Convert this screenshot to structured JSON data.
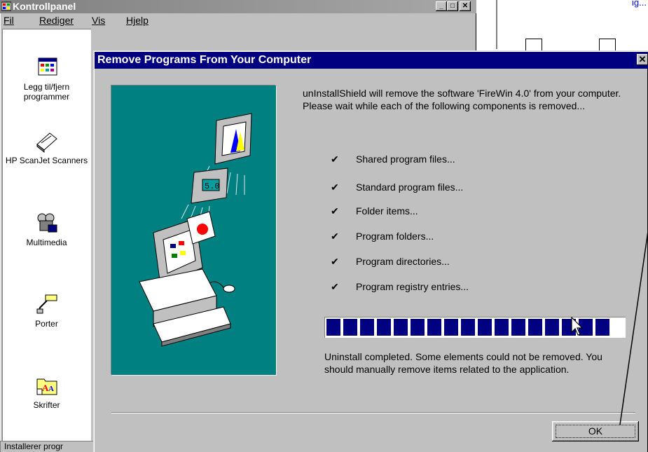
{
  "colors": {
    "desktop": "#ffffff",
    "window_face": "#c0c0c0",
    "active_title": "#000080",
    "inactive_title": "#808080",
    "art_background": "#008080",
    "progress_block": "#000080",
    "link": "#0000ff"
  },
  "background_window": {
    "title": "Kontrollpanel",
    "title_icon": "control-panel-icon",
    "caption_buttons": [
      "_",
      "□",
      "✕"
    ],
    "menu": [
      {
        "label": "Fil"
      },
      {
        "label": "Rediger"
      },
      {
        "label": "Vis"
      },
      {
        "label": "Hjelp"
      }
    ],
    "icons": [
      {
        "icon": "add-remove-programs-icon",
        "label": "Legg til/fjern programmer"
      },
      {
        "icon": "scanner-icon",
        "label": "HP ScanJet Scanners"
      },
      {
        "icon": "multimedia-icon",
        "label": "Multimedia"
      },
      {
        "icon": "ports-icon",
        "label": "Porter"
      },
      {
        "icon": "fonts-folder-icon",
        "label": "Skrifter"
      }
    ],
    "status_text": "Installerer progr"
  },
  "background_right": {
    "link_fragment": "ig...",
    "file_icons": [
      "document-icon",
      "document-icon"
    ]
  },
  "dialog": {
    "title": "Remove Programs From Your Computer",
    "close_glyph": "✕",
    "intro": "unInstallShield will remove the software 'FireWin 4.0' from your computer.  Please wait while each of the following components is removed...",
    "steps": [
      {
        "done": true,
        "check": "✔",
        "label": "Shared program files..."
      },
      {
        "done": true,
        "check": "✔",
        "label": "Standard program files..."
      },
      {
        "done": true,
        "check": "✔",
        "label": "Folder items..."
      },
      {
        "done": true,
        "check": "✔",
        "label": "Program folders..."
      },
      {
        "done": true,
        "check": "✔",
        "label": "Program directories..."
      },
      {
        "done": true,
        "check": "✔",
        "label": "Program registry entries..."
      }
    ],
    "progress_percent": 100,
    "result": "Uninstall completed.  Some elements could not be removed.  You should manually remove items related to the application.",
    "ok_label": "OK",
    "art_icon": "computer-illustration-icon"
  }
}
